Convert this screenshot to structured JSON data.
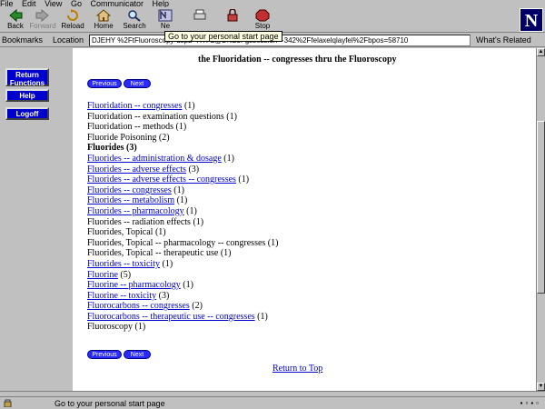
{
  "menu": [
    "File",
    "Edit",
    "View",
    "Go",
    "Communicator",
    "Help"
  ],
  "toolbar": {
    "back": "Back",
    "forward": "Forward",
    "reload": "Reload",
    "home": "Home",
    "search": "Search",
    "netscape": "Ne",
    "print": "Print",
    "security": "Security",
    "stop": "Stop",
    "tooltip": "Go to your personal start page"
  },
  "location": {
    "bookmarks_label": "Bookmarks",
    "location_label": "Location",
    "url": "DJEHY %2FtFluoroscopy-dsp2=HTFL@2%23Fgssession=-342%2Ffelaxelqlayfel%2Fbpos=58710",
    "whats_related": "What's Related"
  },
  "sidebar": {
    "button1": "Return Functions",
    "button2": "Help",
    "button3": "Logoff"
  },
  "main": {
    "heading": "the   Fluoridation  -- congresses  thru the  Fluoroscopy",
    "prev_label": "Previous",
    "next_label": "Next",
    "return_label": "Return to Top",
    "entries": [
      {
        "link": "Fluoridation -- congresses",
        "suffix": " (1)"
      },
      {
        "link": "",
        "suffix": "Fluoridation -- examination questions (1)"
      },
      {
        "link": "",
        "suffix": "Fluoridation -- methods (1)"
      },
      {
        "link": "",
        "suffix": "Fluoride Poisoning (2)"
      },
      {
        "link": "",
        "suffix": "Fluorides (3)",
        "bold": true
      },
      {
        "link": "Fluorides -- administration & dosage",
        "suffix": " (1)"
      },
      {
        "link": "Fluorides -- adverse effects",
        "suffix": " (3)"
      },
      {
        "link": "Fluorides -- adverse effects -- congresses",
        "suffix": " (1)"
      },
      {
        "link": "Fluorides -- congresses",
        "suffix": " (1)"
      },
      {
        "link": "Fluorides -- metabolism",
        "suffix": " (1)"
      },
      {
        "link": "Fluorides -- pharmacology",
        "suffix": " (1)"
      },
      {
        "link": "",
        "suffix": "Fluorides -- radiation effects (1)"
      },
      {
        "link": "",
        "suffix": "Fluorides, Topical (1)"
      },
      {
        "link": "",
        "suffix": "Fluorides, Topical -- pharmacology -- congresses (1)"
      },
      {
        "link": "",
        "suffix": "Fluorides, Topical -- therapeutic use (1)"
      },
      {
        "link": "Fluorides -- toxicity",
        "suffix": " (1)"
      },
      {
        "link": "Fluorine",
        "suffix": " (5)"
      },
      {
        "link": "Fluorine -- pharmacology",
        "suffix": " (1)"
      },
      {
        "link": "Fluorine -- toxicity",
        "suffix": " (3)"
      },
      {
        "link": "Fluorocarbons -- congresses",
        "suffix": " (2)"
      },
      {
        "link": "Fluorocarbons -- therapeutic use -- congresses",
        "suffix": " (1)"
      },
      {
        "link": "",
        "suffix": "Fluoroscopy (1)"
      }
    ]
  },
  "status": {
    "text": "Go to your personal start page"
  }
}
